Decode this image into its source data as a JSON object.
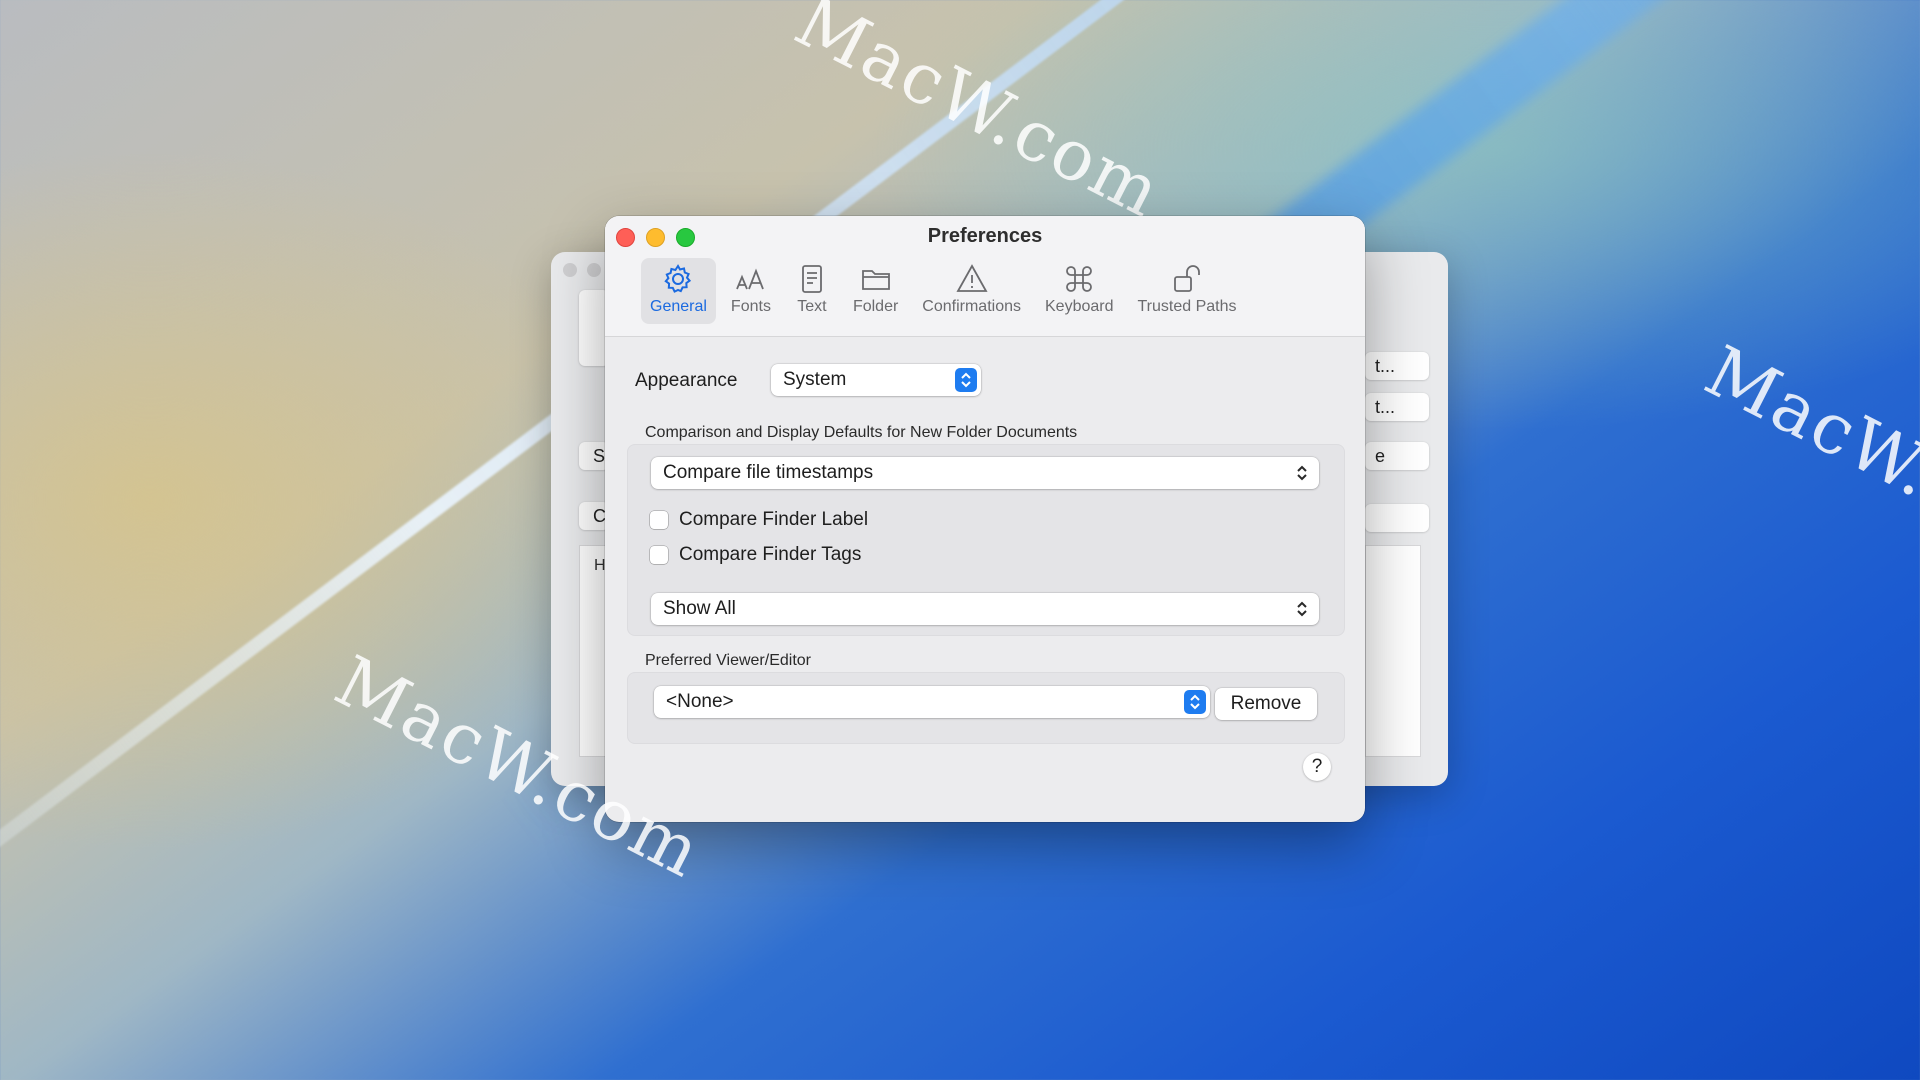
{
  "window": {
    "title": "Preferences",
    "traffic_lights": {
      "close": "#fe5f57",
      "minimize": "#febc2e",
      "maximize": "#28c840"
    }
  },
  "toolbar": {
    "tabs": [
      {
        "label": "General",
        "icon": "gear-icon",
        "active": true
      },
      {
        "label": "Fonts",
        "icon": "fonts-icon",
        "active": false
      },
      {
        "label": "Text",
        "icon": "document-icon",
        "active": false
      },
      {
        "label": "Folder",
        "icon": "folder-icon",
        "active": false
      },
      {
        "label": "Confirmations",
        "icon": "warning-icon",
        "active": false
      },
      {
        "label": "Keyboard",
        "icon": "command-icon",
        "active": false
      },
      {
        "label": "Trusted Paths",
        "icon": "unlock-icon",
        "active": false
      }
    ],
    "accent": "#1b6ae0"
  },
  "general": {
    "appearance_label": "Appearance",
    "appearance_value": "System",
    "comparison_heading": "Comparison and Display Defaults for New Folder Documents",
    "compare_method": "Compare file timestamps",
    "compare_finder_label": {
      "label": "Compare Finder Label",
      "checked": false
    },
    "compare_finder_tags": {
      "label": "Compare Finder Tags",
      "checked": false
    },
    "display_filter": "Show All",
    "viewer_heading": "Preferred Viewer/Editor",
    "viewer_value": "<None>",
    "remove_label": "Remove",
    "help_label": "?"
  },
  "background_window": {
    "buttons": [
      "t...",
      "t...",
      "e"
    ],
    "left_buttons": [
      "S",
      "C"
    ],
    "panel_text": "H"
  },
  "desktop": {
    "watermarks": [
      "MacW.com",
      "MacW.c",
      "MacW.com"
    ]
  }
}
